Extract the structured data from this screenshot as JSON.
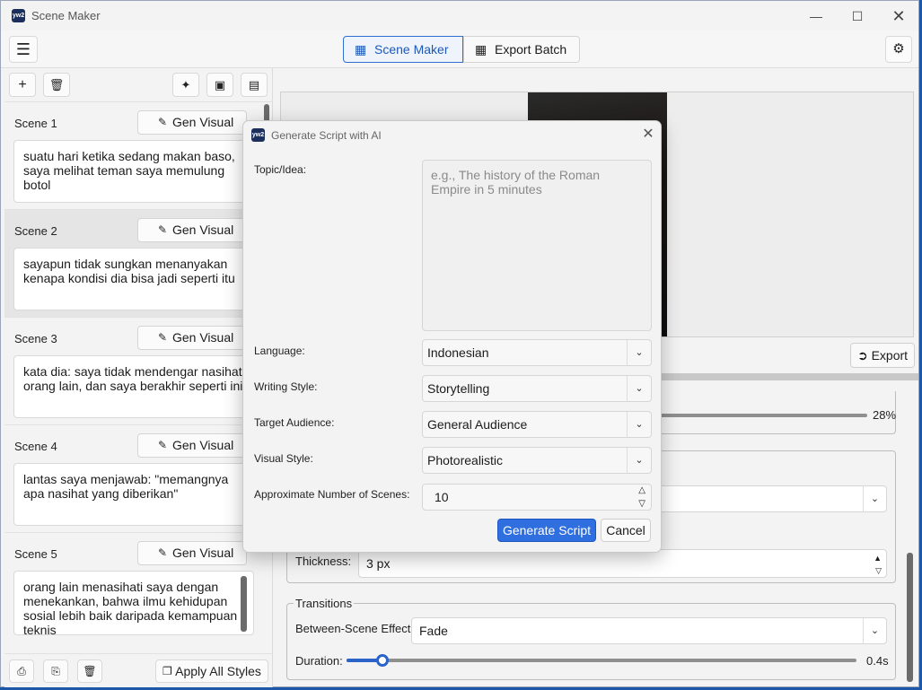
{
  "window": {
    "title": "Scene Maker",
    "logo_text": "yw2"
  },
  "toolbar": {
    "tabs": [
      {
        "label": "Scene Maker",
        "active": true
      },
      {
        "label": "Export Batch",
        "active": false
      }
    ]
  },
  "scenes": [
    {
      "label": "Scene 1",
      "gen_label": "Gen Visual",
      "text": "suatu hari ketika sedang makan baso, saya melihat teman saya memulung botol"
    },
    {
      "label": "Scene 2",
      "gen_label": "Gen Visual",
      "text": "sayapun tidak sungkan menanyakan kenapa kondisi  dia bisa jadi seperti itu"
    },
    {
      "label": "Scene 3",
      "gen_label": "Gen Visual",
      "text": "kata dia: saya tidak mendengar nasihat orang lain, dan saya berakhir seperti ini"
    },
    {
      "label": "Scene 4",
      "gen_label": "Gen Visual",
      "text": "lantas saya menjawab: \"memangnya apa nasihat yang diberikan\""
    },
    {
      "label": "Scene 5",
      "gen_label": "Gen Visual",
      "text": "orang lain menasihati saya dengan menekankan, bahwa ilmu kehidupan sosial lebih baik daripada kemampuan teknis"
    }
  ],
  "left_bottom": {
    "apply_all_label": "Apply All Styles"
  },
  "preview": {
    "export_label": "Export"
  },
  "style_panel": {
    "progress_value": "28%",
    "progress_fraction": 0.28,
    "thickness_label": "Thickness:",
    "thickness_value": "3 px",
    "transitions_title": "Transitions",
    "between_scene_label": "Between-Scene Effect:",
    "between_scene_value": "Fade",
    "duration_label": "Duration:",
    "duration_value": "0.4s"
  },
  "dialog": {
    "title": "Generate Script with AI",
    "logo_text": "yw2",
    "topic_label": "Topic/Idea:",
    "topic_placeholder": "e.g., The history of the Roman Empire in 5 minutes",
    "language_label": "Language:",
    "language_value": "Indonesian",
    "writing_style_label": "Writing Style:",
    "writing_style_value": "Storytelling",
    "audience_label": "Target Audience:",
    "audience_value": "General Audience",
    "visual_style_label": "Visual Style:",
    "visual_style_value": "Photorealistic",
    "num_scenes_label": "Approximate Number of Scenes:",
    "num_scenes_value": "10",
    "generate_label": "Generate Script",
    "cancel_label": "Cancel"
  },
  "colors": {
    "accent": "#2f6fe0",
    "accent_dark": "#1d58b8",
    "desktop": "#1c57a8"
  }
}
